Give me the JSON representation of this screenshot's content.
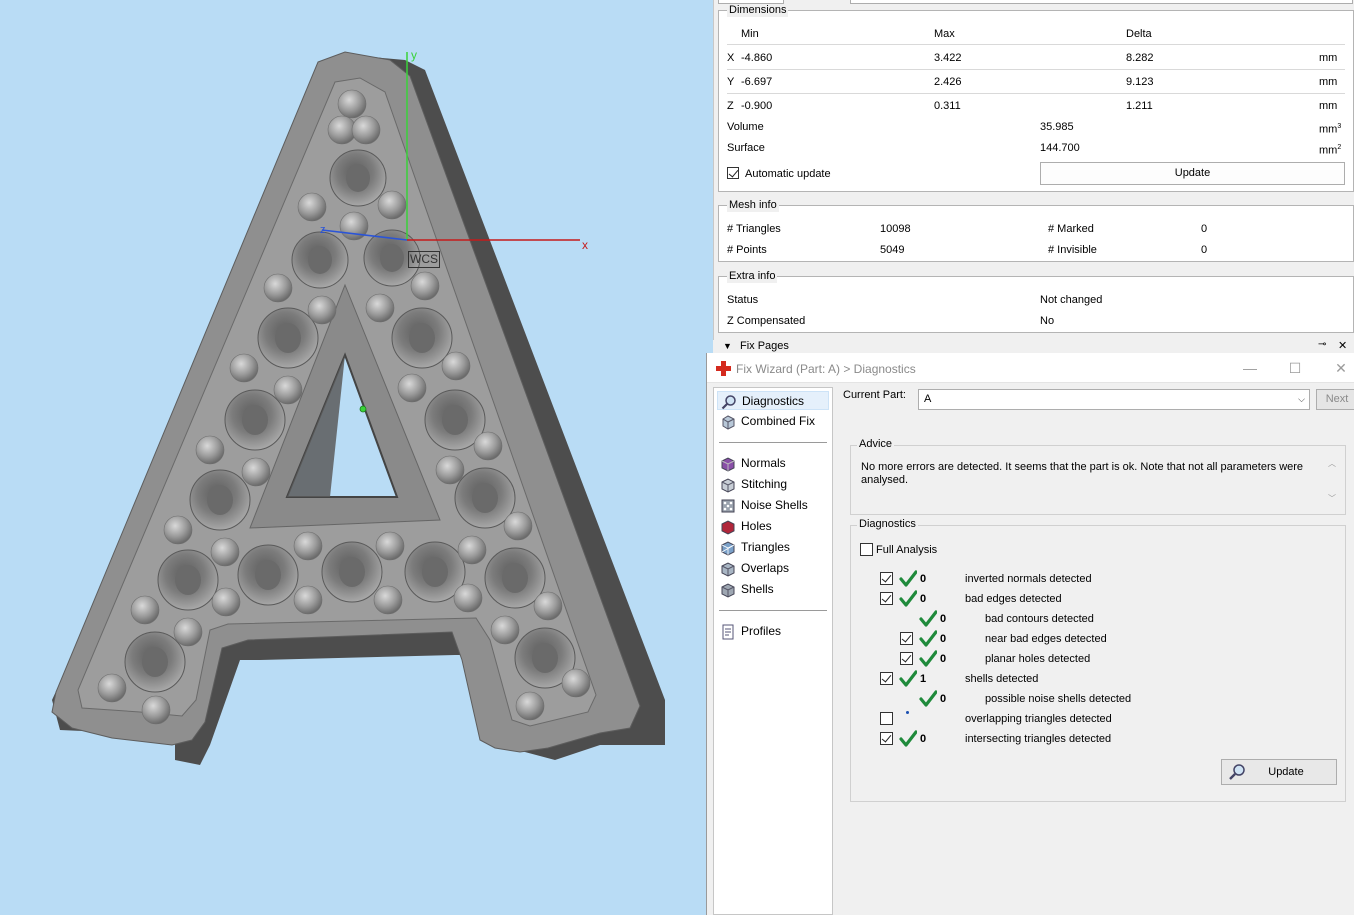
{
  "viewport": {
    "axis_y": "y",
    "axis_x": "x",
    "axis_z": "z",
    "wcs_label": "WCS"
  },
  "dimensions": {
    "title": "Dimensions",
    "headers": {
      "min": "Min",
      "max": "Max",
      "delta": "Delta"
    },
    "rows": [
      {
        "axis": "X",
        "min": "-4.860",
        "max": "3.422",
        "delta": "8.282",
        "unit": "mm"
      },
      {
        "axis": "Y",
        "min": "-6.697",
        "max": "2.426",
        "delta": "9.123",
        "unit": "mm"
      },
      {
        "axis": "Z",
        "min": "-0.900",
        "max": "0.311",
        "delta": "1.211",
        "unit": "mm"
      }
    ],
    "volume_label": "Volume",
    "volume_value": "35.985",
    "volume_unit": "mm",
    "volume_unit_sup": "3",
    "surface_label": "Surface",
    "surface_value": "144.700",
    "surface_unit": "mm",
    "surface_unit_sup": "2",
    "auto_update_label": "Automatic update",
    "auto_update_checked": true,
    "update_button": "Update"
  },
  "mesh_info": {
    "title": "Mesh info",
    "triangles_label": "# Triangles",
    "triangles_value": "10098",
    "marked_label": "# Marked",
    "marked_value": "0",
    "points_label": "# Points",
    "points_value": "5049",
    "invisible_label": "# Invisible",
    "invisible_value": "0"
  },
  "extra_info": {
    "title": "Extra info",
    "status_label": "Status",
    "status_value": "Not changed",
    "zcomp_label": "Z Compensated",
    "zcomp_value": "No"
  },
  "fix_pages": {
    "label": "Fix Pages",
    "pin_icon": "pin-icon",
    "close_icon": "close-icon"
  },
  "wizard": {
    "title": "Fix Wizard (Part: A) > Diagnostics",
    "nav": [
      {
        "label": "Diagnostics",
        "icon": "magnifier-icon",
        "selected": true
      },
      {
        "label": "Combined Fix",
        "icon": "cube-icon"
      },
      {
        "label": "Normals",
        "icon": "normals-icon"
      },
      {
        "label": "Stitching",
        "icon": "stitching-icon"
      },
      {
        "label": "Noise Shells",
        "icon": "noise-shells-icon"
      },
      {
        "label": "Holes",
        "icon": "holes-icon"
      },
      {
        "label": "Triangles",
        "icon": "triangles-icon"
      },
      {
        "label": "Overlaps",
        "icon": "overlaps-icon"
      },
      {
        "label": "Shells",
        "icon": "shells-icon"
      },
      {
        "label": "Profiles",
        "icon": "profiles-icon"
      }
    ],
    "current_part_label": "Current Part:",
    "current_part_value": "A",
    "next_button": "Next",
    "advice_title": "Advice",
    "advice_text": "No more errors are detected. It seems that the part is ok. Note that not all parameters were analysed.",
    "diagnostics_title": "Diagnostics",
    "full_analysis_label": "Full Analysis",
    "full_analysis_checked": false,
    "items": [
      {
        "checked": true,
        "ok": true,
        "count": "0",
        "label": "inverted normals detected",
        "indent": 0,
        "has_checkbox": true
      },
      {
        "checked": true,
        "ok": true,
        "count": "0",
        "label": "bad edges detected",
        "indent": 0,
        "has_checkbox": true
      },
      {
        "checked": false,
        "ok": true,
        "count": "0",
        "label": "bad contours detected",
        "indent": 1,
        "has_checkbox": false
      },
      {
        "checked": true,
        "ok": true,
        "count": "0",
        "label": "near bad edges detected",
        "indent": 1,
        "has_checkbox": true
      },
      {
        "checked": true,
        "ok": true,
        "count": "0",
        "label": "planar holes detected",
        "indent": 1,
        "has_checkbox": true
      },
      {
        "checked": true,
        "ok": true,
        "count": "1",
        "label": "shells detected",
        "indent": 0,
        "has_checkbox": true
      },
      {
        "checked": false,
        "ok": true,
        "count": "0",
        "label": "possible noise shells detected",
        "indent": 1,
        "has_checkbox": false
      },
      {
        "checked": false,
        "ok": false,
        "count": "",
        "label": "overlapping triangles detected",
        "indent": 0,
        "has_checkbox": true
      },
      {
        "checked": true,
        "ok": true,
        "count": "0",
        "label": "intersecting triangles detected",
        "indent": 0,
        "has_checkbox": true
      }
    ],
    "update_button": "Update"
  }
}
